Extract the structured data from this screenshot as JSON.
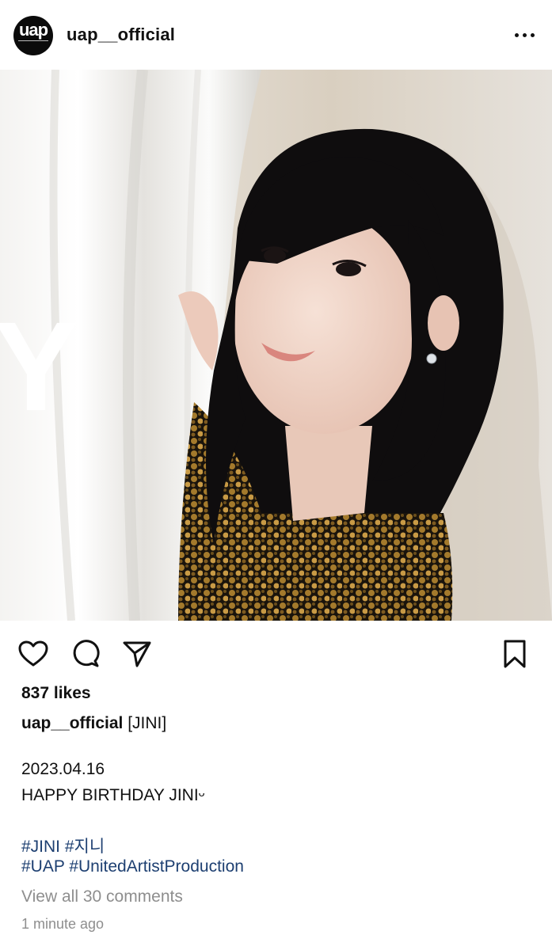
{
  "post": {
    "username": "uap__official",
    "avatar": {
      "logo_text": "uap",
      "logo_subtext": "united artist production"
    },
    "more_icon": "more-dots-icon",
    "photo": {
      "overlay_letter": "Y",
      "alt": "Portrait photo"
    },
    "actions": {
      "like_icon": "heart-icon",
      "comment_icon": "comment-bubble-icon",
      "share_icon": "paper-plane-icon",
      "save_icon": "bookmark-icon"
    },
    "likes_text": "837 likes",
    "caption": {
      "username": "uap__official",
      "text": "[JINI]",
      "date": "2023.04.16",
      "message": "HAPPY BIRTHDAY JINIᵕ",
      "hashtags_line1": [
        "#JINI",
        "#지니"
      ],
      "hashtags_line2": [
        "#UAP",
        "#UnitedArtistProduction"
      ]
    },
    "comments_link": "View all 30 comments",
    "timestamp": "1 minute ago"
  },
  "colors": {
    "hashtag": "#1d3f71",
    "muted": "#8e8e8e",
    "text": "#111111"
  }
}
